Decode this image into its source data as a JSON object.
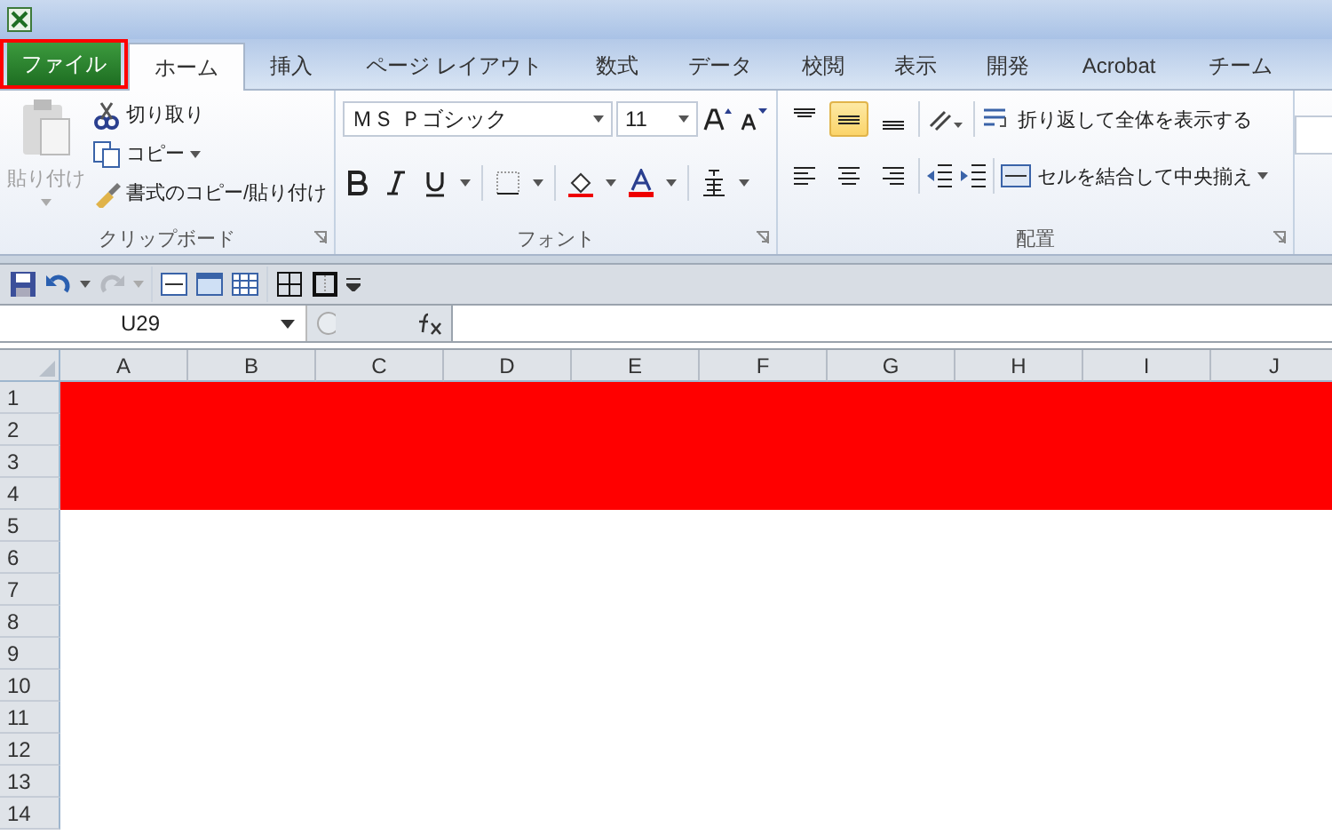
{
  "tabs": [
    {
      "label": "ファイル",
      "kind": "file",
      "selected": false
    },
    {
      "label": "ホーム",
      "kind": "tab",
      "selected": true
    },
    {
      "label": "挿入",
      "kind": "tab",
      "selected": false
    },
    {
      "label": "ページ レイアウト",
      "kind": "tab",
      "selected": false
    },
    {
      "label": "数式",
      "kind": "tab",
      "selected": false
    },
    {
      "label": "データ",
      "kind": "tab",
      "selected": false
    },
    {
      "label": "校閲",
      "kind": "tab",
      "selected": false
    },
    {
      "label": "表示",
      "kind": "tab",
      "selected": false
    },
    {
      "label": "開発",
      "kind": "tab",
      "selected": false
    },
    {
      "label": "Acrobat",
      "kind": "tab",
      "selected": false
    },
    {
      "label": "チーム",
      "kind": "tab",
      "selected": false
    }
  ],
  "clipboard": {
    "title": "クリップボード",
    "paste_label": "貼り付け",
    "paste_disabled": true,
    "cut": "切り取り",
    "copy": "コピー",
    "format_painter": "書式のコピー/貼り付け"
  },
  "font": {
    "title": "フォント",
    "font_name": "ＭＳ Ｐゴシック",
    "font_size": "11"
  },
  "alignment": {
    "title": "配置",
    "middle_selected": true,
    "wrap_text": "折り返して全体を表示する",
    "merge_center": "セルを結合して中央揃え"
  },
  "quick_access": {
    "redo_disabled": true
  },
  "formula_bar": {
    "name_box": "U29"
  },
  "sheet": {
    "columns": [
      "A",
      "B",
      "C",
      "D",
      "E",
      "F",
      "G",
      "H",
      "I",
      "J"
    ],
    "rows": [
      {
        "label": "1",
        "color": "#ff0000"
      },
      {
        "label": "2",
        "color": "#ff0000"
      },
      {
        "label": "3",
        "color": "#ff0000"
      },
      {
        "label": "4",
        "color": "#ff0000"
      },
      {
        "label": "5"
      },
      {
        "label": "6"
      },
      {
        "label": "7"
      },
      {
        "label": "8"
      },
      {
        "label": "9"
      },
      {
        "label": "10"
      },
      {
        "label": "11"
      },
      {
        "label": "12"
      },
      {
        "label": "13"
      },
      {
        "label": "14"
      }
    ]
  }
}
